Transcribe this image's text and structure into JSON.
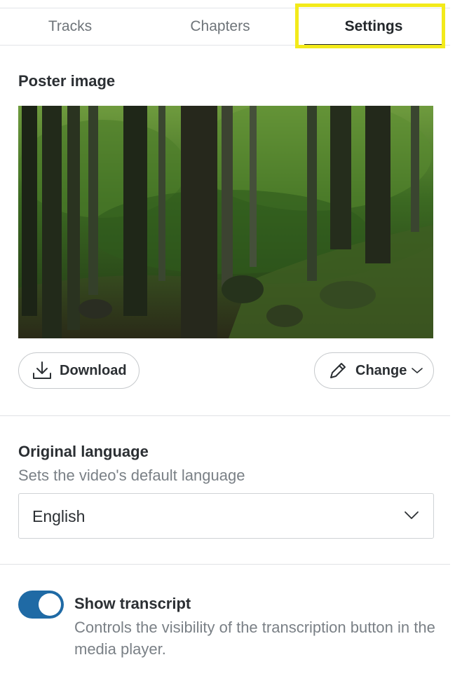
{
  "tabs": [
    {
      "label": "Tracks",
      "selected": false
    },
    {
      "label": "Chapters",
      "selected": false
    },
    {
      "label": "Settings",
      "selected": true
    }
  ],
  "poster": {
    "title": "Poster image",
    "image_description_icon": "forest-image",
    "download_label": "Download",
    "download_icon": "download-icon",
    "change_label": "Change",
    "change_icon": "pencil-icon"
  },
  "language": {
    "title": "Original language",
    "subtitle": "Sets the video's default language",
    "selected": "English"
  },
  "transcript": {
    "label": "Show transcript",
    "description": "Controls the visibility of the transcription button in the media player.",
    "enabled": true
  },
  "colors": {
    "accent": "#1f6aa5",
    "highlight": "#f3ea1a"
  }
}
